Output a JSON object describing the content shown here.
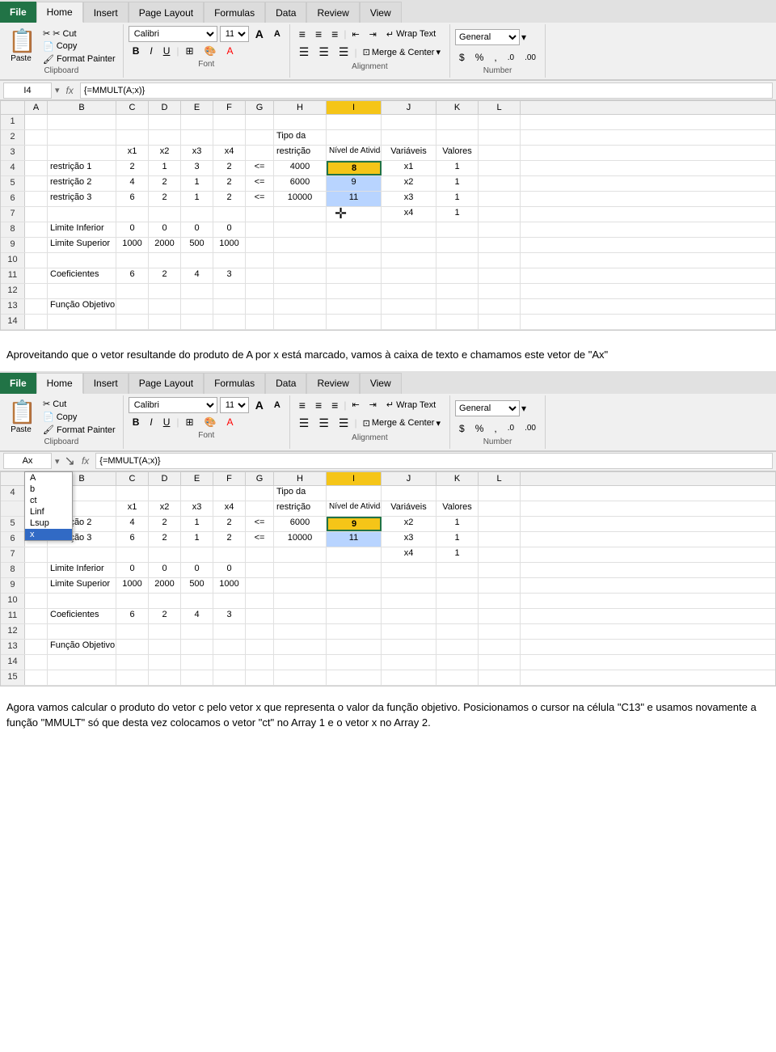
{
  "ribbon1": {
    "tabs": [
      "File",
      "Home",
      "Insert",
      "Page Layout",
      "Formulas",
      "Data",
      "Review",
      "View"
    ],
    "active_tab": "Home",
    "clipboard": {
      "paste_label": "Paste",
      "cut_label": "✂ Cut",
      "copy_label": "Copy",
      "format_painter_label": "Format Painter",
      "group_label": "Clipboard"
    },
    "font": {
      "name": "Calibri",
      "size": "11",
      "grow_label": "A",
      "shrink_label": "A",
      "bold_label": "B",
      "italic_label": "I",
      "underline_label": "U",
      "group_label": "Font"
    },
    "alignment": {
      "wrap_text_label": "Wrap Text",
      "merge_center_label": "Merge & Center",
      "group_label": "Alignment"
    },
    "number": {
      "format": "General",
      "percent_label": "%",
      "comma_label": ",",
      "group_label": "Number"
    }
  },
  "formula_bar1": {
    "cell_ref": "I4",
    "formula": "{=MMULT(A;x)}"
  },
  "spreadsheet1": {
    "col_headers": [
      "",
      "A",
      "B",
      "C",
      "D",
      "E",
      "F",
      "G",
      "H",
      "I",
      "J",
      "K",
      "L"
    ],
    "active_col": "I",
    "rows": [
      {
        "num": "1",
        "cells": [
          "",
          "",
          "",
          "",
          "",
          "",
          "",
          "",
          "",
          "",
          "",
          "",
          ""
        ]
      },
      {
        "num": "2",
        "cells": [
          "",
          "",
          "",
          "",
          "",
          "",
          "",
          "",
          "Tipo da",
          "",
          "",
          "",
          ""
        ]
      },
      {
        "num": "3",
        "cells": [
          "",
          "",
          "",
          "x1",
          "x2",
          "x3",
          "x4",
          "",
          "restrição",
          "Nível de Atividade",
          "Variáveis",
          "Valores",
          ""
        ]
      },
      {
        "num": "4",
        "cells": [
          "",
          "restrição 1",
          "",
          "2",
          "1",
          "3",
          "2",
          "<=",
          "4000",
          "8",
          "x1",
          "1",
          ""
        ],
        "highlight_i": true
      },
      {
        "num": "5",
        "cells": [
          "",
          "restrição 2",
          "",
          "4",
          "2",
          "1",
          "2",
          "<=",
          "6000",
          "9",
          "x2",
          "1",
          ""
        ],
        "selected_i": true
      },
      {
        "num": "6",
        "cells": [
          "",
          "restrição 3",
          "",
          "6",
          "2",
          "1",
          "2",
          "<=",
          "10000",
          "11",
          "x3",
          "1",
          ""
        ],
        "selected_i": true
      },
      {
        "num": "7",
        "cells": [
          "",
          "",
          "",
          "",
          "",
          "",
          "",
          "",
          "",
          "",
          "x4",
          "1",
          ""
        ]
      },
      {
        "num": "8",
        "cells": [
          "",
          "Limite Inferior",
          "",
          "0",
          "0",
          "0",
          "0",
          "",
          "",
          "",
          "",
          "",
          ""
        ]
      },
      {
        "num": "9",
        "cells": [
          "",
          "Limite Superior",
          "",
          "1000",
          "2000",
          "500",
          "1000",
          "",
          "",
          "",
          "",
          "",
          ""
        ]
      },
      {
        "num": "10",
        "cells": [
          "",
          "",
          "",
          "",
          "",
          "",
          "",
          "",
          "",
          "",
          "",
          "",
          ""
        ]
      },
      {
        "num": "11",
        "cells": [
          "",
          "Coeficientes",
          "",
          "6",
          "2",
          "4",
          "3",
          "",
          "",
          "",
          "",
          "",
          ""
        ]
      },
      {
        "num": "12",
        "cells": [
          "",
          "",
          "",
          "",
          "",
          "",
          "",
          "",
          "",
          "",
          "",
          "",
          ""
        ]
      },
      {
        "num": "13",
        "cells": [
          "",
          "Função Objetivo",
          "",
          "",
          "",
          "",
          "",
          "",
          "",
          "",
          "",
          "",
          ""
        ]
      },
      {
        "num": "14",
        "cells": [
          "",
          "",
          "",
          "",
          "",
          "",
          "",
          "",
          "",
          "",
          "",
          "",
          ""
        ]
      }
    ],
    "plus_cursor": true
  },
  "text_block1": {
    "text": "Aproveitando que o vetor resultande do produto de A por x está marcado, vamos à caixa de texto e chamamos este vetor de \"Ax\""
  },
  "formula_bar2": {
    "cell_ref": "Ax",
    "formula": "{=MMULT(A;x)}"
  },
  "spreadsheet2": {
    "col_headers": [
      "",
      "A",
      "B",
      "C",
      "D",
      "E",
      "F",
      "G",
      "H",
      "I",
      "J",
      "K",
      "L"
    ],
    "active_col": "I",
    "dropdown_items": [
      "A",
      "b",
      "ct",
      "Linf",
      "Lsup",
      "x"
    ],
    "dropdown_highlighted": "x",
    "rows": [
      {
        "num": "4",
        "cells": [
          "",
          "",
          "",
          "",
          "",
          "",
          "",
          "",
          "",
          "",
          "",
          "",
          ""
        ]
      },
      {
        "num": "5",
        "cells": [
          "",
          "restrição 2",
          "",
          "4",
          "2",
          "1",
          "2",
          "<=",
          "6000",
          "9",
          "x2",
          "1",
          ""
        ],
        "selected_i": true
      },
      {
        "num": "6",
        "cells": [
          "",
          "restrição 3",
          "",
          "6",
          "2",
          "1",
          "2",
          "<=",
          "10000",
          "11",
          "x3",
          "1",
          ""
        ],
        "selected_i": true
      },
      {
        "num": "7",
        "cells": [
          "",
          "",
          "",
          "",
          "",
          "",
          "",
          "",
          "",
          "",
          "x4",
          "1",
          ""
        ]
      },
      {
        "num": "8",
        "cells": [
          "",
          "Limite Inferior",
          "",
          "0",
          "0",
          "0",
          "0",
          "",
          "",
          "",
          "",
          "",
          ""
        ]
      },
      {
        "num": "9",
        "cells": [
          "",
          "Limite Superior",
          "",
          "1000",
          "2000",
          "500",
          "1000",
          "",
          "",
          "",
          "",
          "",
          ""
        ]
      },
      {
        "num": "10",
        "cells": [
          "",
          "",
          "",
          "",
          "",
          "",
          "",
          "",
          "",
          "",
          "",
          "",
          ""
        ]
      },
      {
        "num": "11",
        "cells": [
          "",
          "Coeficientes",
          "",
          "6",
          "2",
          "4",
          "3",
          "",
          "",
          "",
          "",
          "",
          ""
        ]
      },
      {
        "num": "12",
        "cells": [
          "",
          "",
          "",
          "",
          "",
          "",
          "",
          "",
          "",
          "",
          "",
          "",
          ""
        ]
      },
      {
        "num": "13",
        "cells": [
          "",
          "Função Objetivo",
          "",
          "",
          "",
          "",
          "",
          "",
          "",
          "",
          "",
          "",
          ""
        ]
      },
      {
        "num": "14",
        "cells": [
          "",
          "",
          "",
          "",
          "",
          "",
          "",
          "",
          "",
          "",
          "",
          "",
          ""
        ]
      },
      {
        "num": "15",
        "cells": [
          "",
          "",
          "",
          "",
          "",
          "",
          "",
          "",
          "",
          "",
          "",
          "",
          ""
        ]
      }
    ]
  },
  "text_block2": {
    "text": "Agora vamos calcular o produto do vetor c pelo vetor x que representa o valor da função objetivo. Posicionamos o cursor na célula  \"C13\" e usamos novamente a função \"MMULT\" só que desta  vez colocamos o vetor \"ct\" no Array 1 e o vetor x no Array 2."
  }
}
